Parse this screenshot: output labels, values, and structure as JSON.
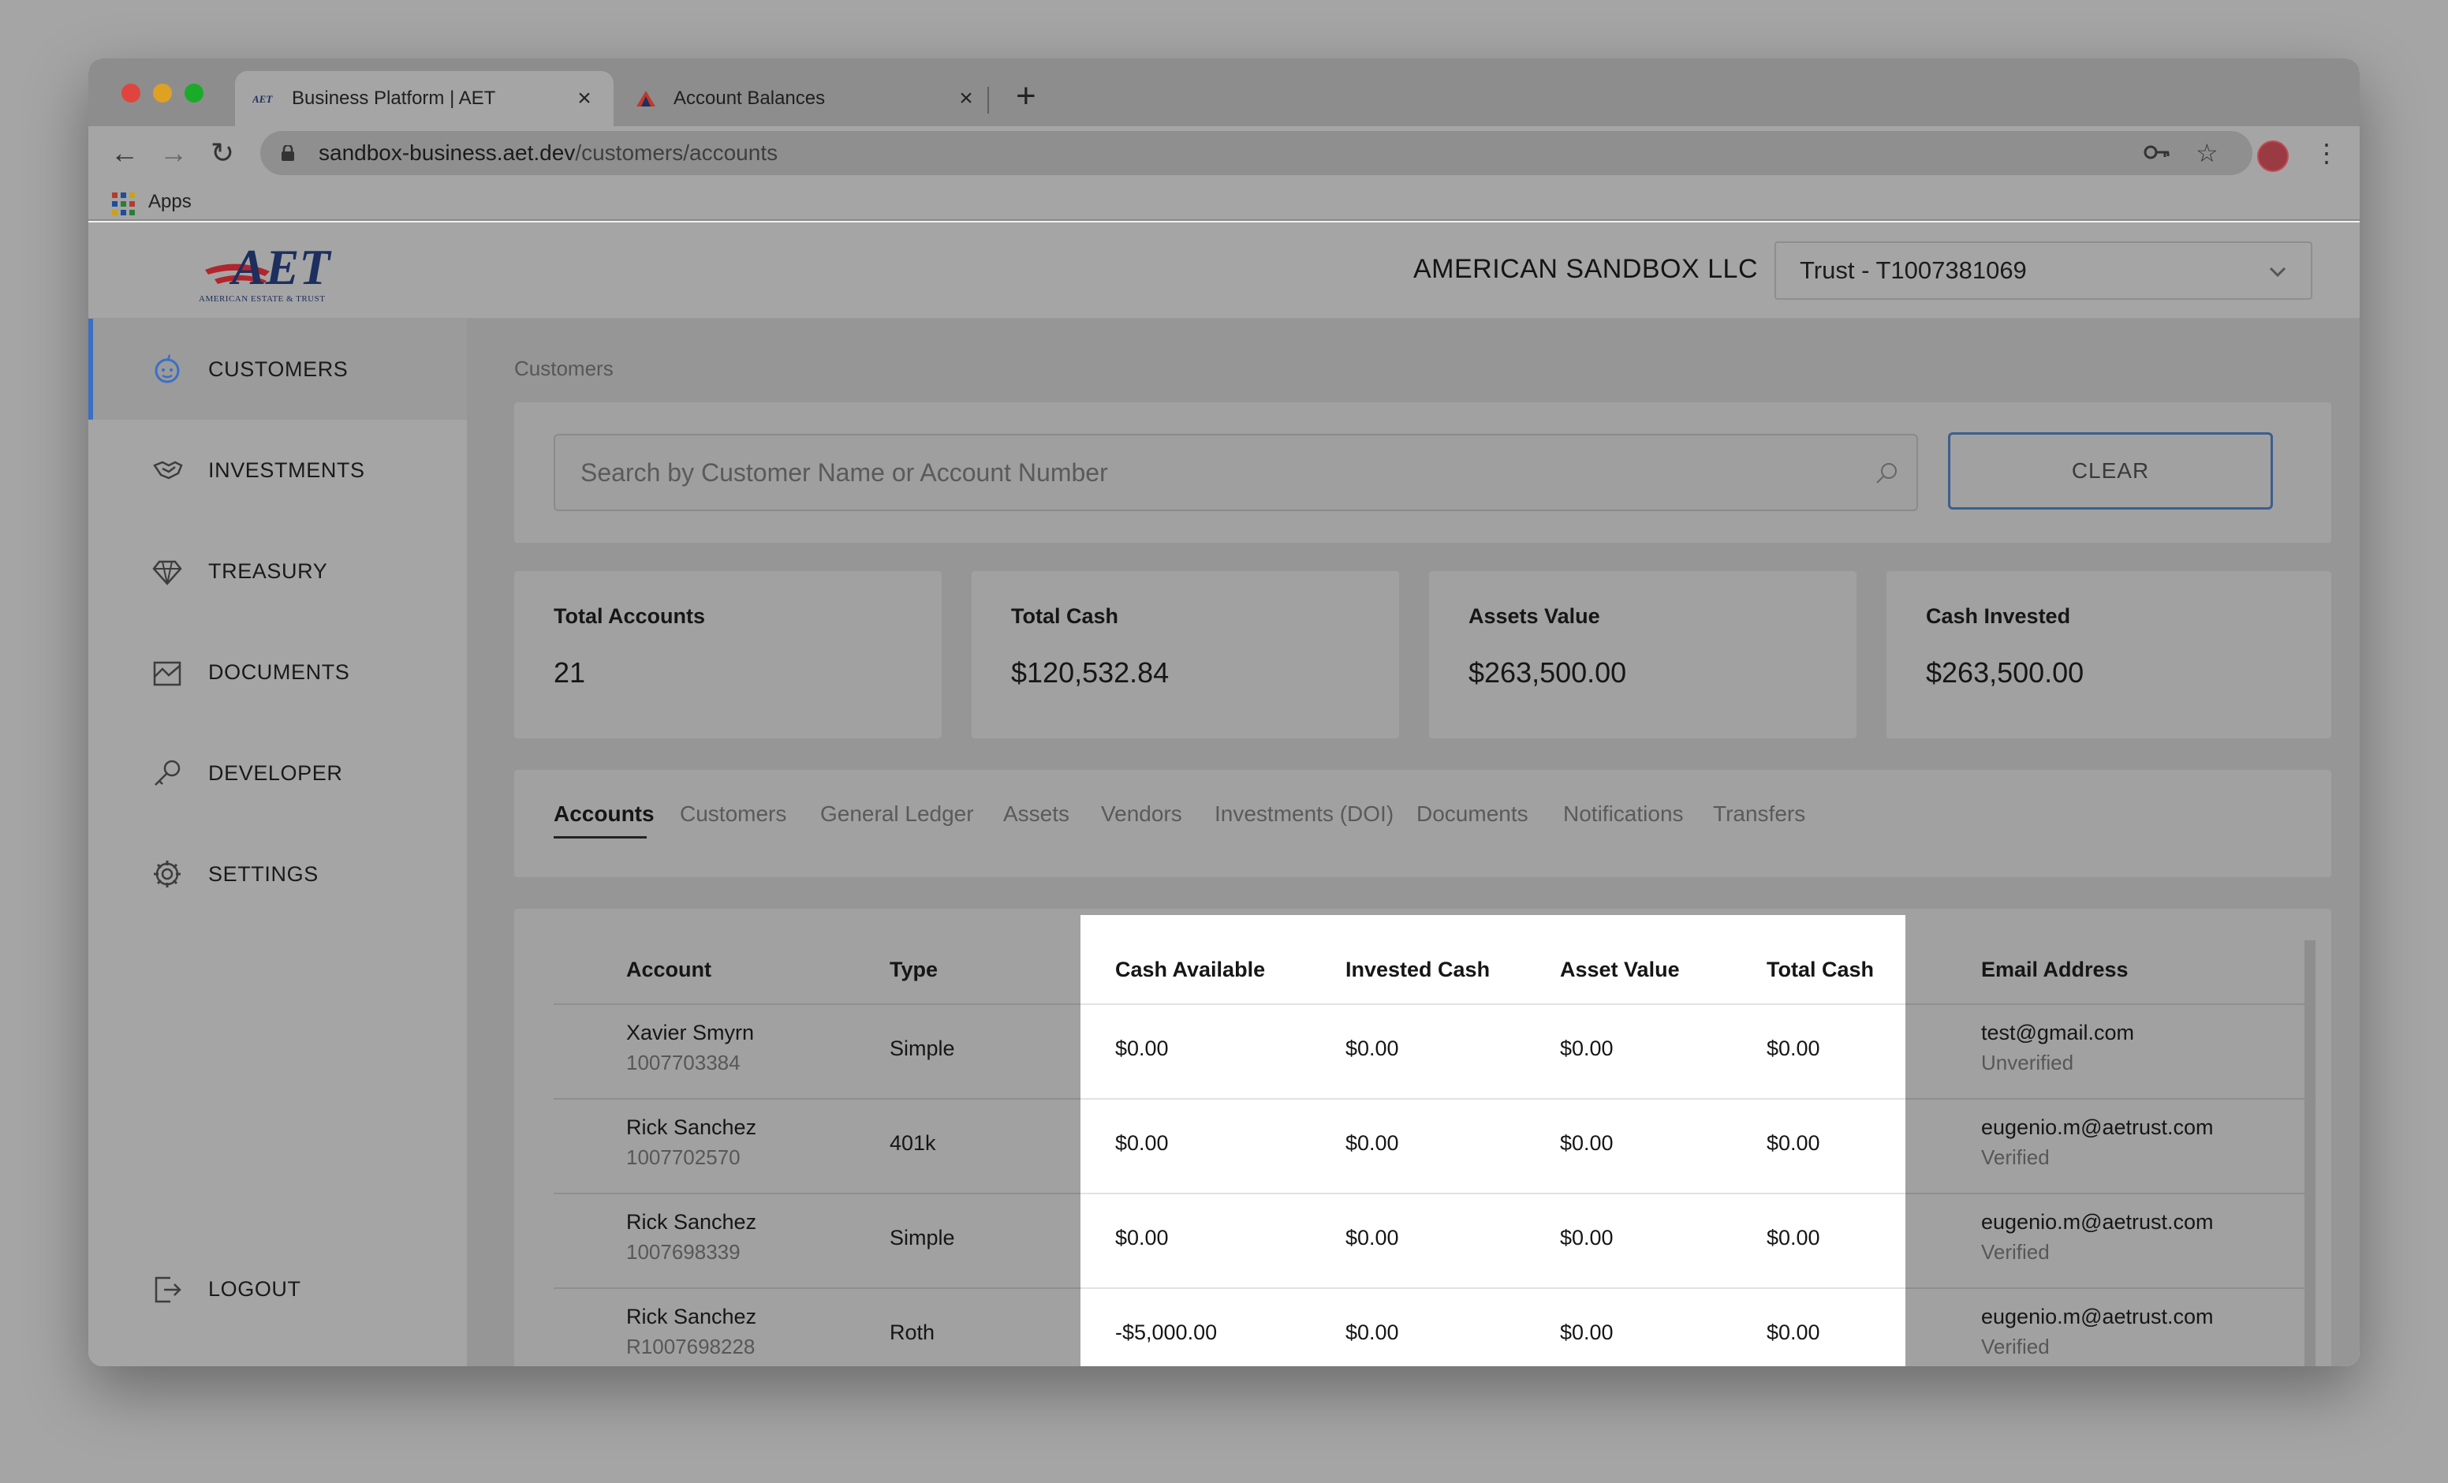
{
  "browser": {
    "tabs": [
      {
        "title": "Business Platform | AET",
        "favicon": "aet-logo-icon",
        "active": true
      },
      {
        "title": "Account Balances",
        "favicon": "red-triangle-icon",
        "active": false
      }
    ],
    "url_host": "sandbox-business.aet.dev",
    "url_path": "/customers/accounts",
    "bookmarks": {
      "apps_label": "Apps"
    }
  },
  "header": {
    "logo_text": "AET",
    "logo_subtext": "AMERICAN ESTATE & TRUST",
    "company_name": "AMERICAN SANDBOX LLC",
    "account_selector": "Trust - T1007381069"
  },
  "sidebar": {
    "items": [
      {
        "label": "CUSTOMERS",
        "icon": "customers-icon",
        "active": true
      },
      {
        "label": "INVESTMENTS",
        "icon": "handshake-icon",
        "active": false
      },
      {
        "label": "TREASURY",
        "icon": "diamond-icon",
        "active": false
      },
      {
        "label": "DOCUMENTS",
        "icon": "documents-icon",
        "active": false
      },
      {
        "label": "DEVELOPER",
        "icon": "key-icon",
        "active": false
      },
      {
        "label": "SETTINGS",
        "icon": "gear-icon",
        "active": false
      }
    ],
    "logout": "LOGOUT"
  },
  "main": {
    "breadcrumb": "Customers",
    "search": {
      "placeholder": "Search by Customer Name or Account Number",
      "clear_label": "CLEAR"
    },
    "stats": [
      {
        "label": "Total Accounts",
        "value": "21"
      },
      {
        "label": "Total Cash",
        "value": "$120,532.84"
      },
      {
        "label": "Assets Value",
        "value": "$263,500.00"
      },
      {
        "label": "Cash Invested",
        "value": "$263,500.00"
      }
    ],
    "tabs": [
      "Accounts",
      "Customers",
      "General Ledger",
      "Assets",
      "Vendors",
      "Investments (DOI)",
      "Documents",
      "Notifications",
      "Transfers"
    ],
    "active_tab": "Accounts",
    "table": {
      "columns": [
        "Account",
        "Type",
        "Cash Available",
        "Invested Cash",
        "Asset Value",
        "Total Cash",
        "Email Address"
      ],
      "rows": [
        {
          "name": "Xavier Smyrn",
          "number": "1007703384",
          "type": "Simple",
          "cash_available": "$0.00",
          "invested_cash": "$0.00",
          "asset_value": "$0.00",
          "total_cash": "$0.00",
          "email": "test@gmail.com",
          "status": "Unverified"
        },
        {
          "name": "Rick Sanchez",
          "number": "1007702570",
          "type": "401k",
          "cash_available": "$0.00",
          "invested_cash": "$0.00",
          "asset_value": "$0.00",
          "total_cash": "$0.00",
          "email": "eugenio.m@aetrust.com",
          "status": "Verified"
        },
        {
          "name": "Rick Sanchez",
          "number": "1007698339",
          "type": "Simple",
          "cash_available": "$0.00",
          "invested_cash": "$0.00",
          "asset_value": "$0.00",
          "total_cash": "$0.00",
          "email": "eugenio.m@aetrust.com",
          "status": "Verified"
        },
        {
          "name": "Rick Sanchez",
          "number": "R1007698228",
          "type": "Roth",
          "cash_available": "-$5,000.00",
          "invested_cash": "$0.00",
          "asset_value": "$0.00",
          "total_cash": "$0.00",
          "email": "eugenio.m@aetrust.com",
          "status": "Verified"
        }
      ]
    }
  },
  "colors": {
    "accent": "#3b6fc4",
    "brand_red": "#b0262c",
    "brand_navy": "#1d2f5e",
    "clear_border": "#3d5e8e"
  }
}
